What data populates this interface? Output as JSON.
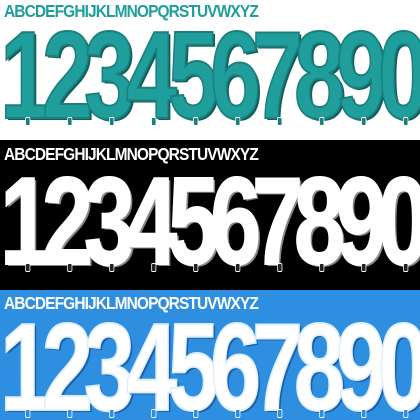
{
  "teal_set": {
    "alphabet": "ABCDEFGHIJKLMNOPQRSTUVWXYZ",
    "digits": [
      "1",
      "2",
      "3",
      "4",
      "5",
      "6",
      "7",
      "8",
      "9",
      "0"
    ],
    "color": "#1f9e9c"
  },
  "black_set": {
    "alphabet": "ABCDEFGHIJKLMNOPQRSTUVWXYZ",
    "digits": [
      "1",
      "2",
      "3",
      "4",
      "5",
      "6",
      "7",
      "8",
      "9",
      "0"
    ],
    "background": "#000000",
    "color": "#ffffff"
  },
  "blue_set": {
    "alphabet": "ABCDEFGHIJKLMNOPQRSTUVWXYZ",
    "digits": [
      "1",
      "2",
      "3",
      "4",
      "5",
      "6",
      "7",
      "8",
      "9",
      "0"
    ],
    "background": "#2e8fe0",
    "color": "#ffffff"
  },
  "icons": {
    "crest": "club-crest-icon"
  }
}
